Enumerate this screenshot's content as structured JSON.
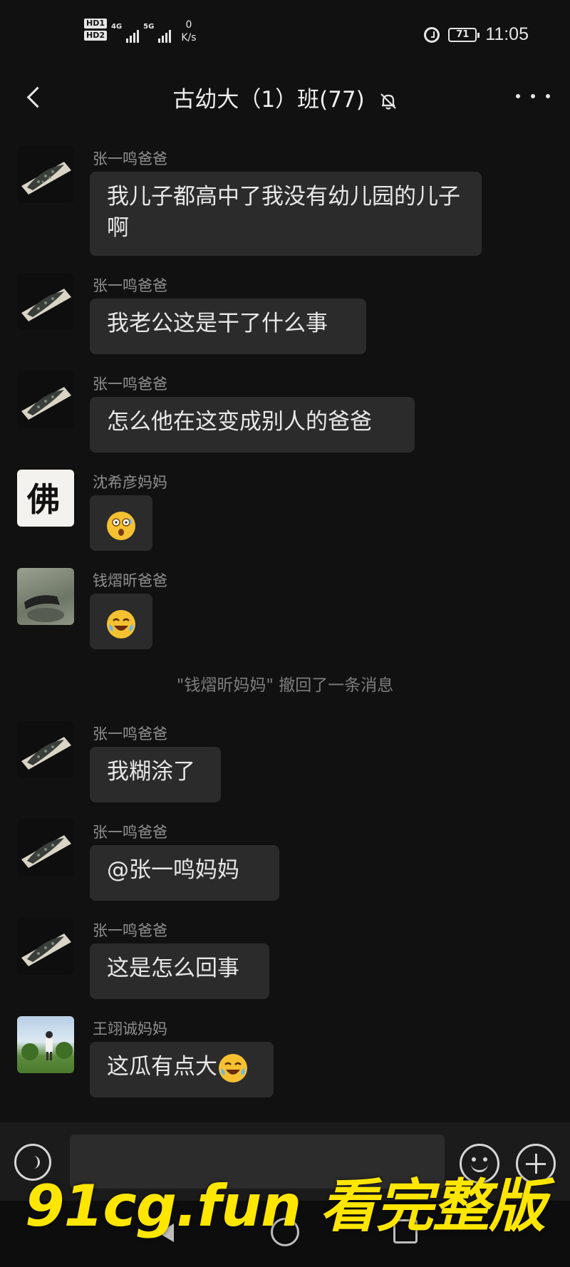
{
  "status_bar": {
    "sim1": "HD1",
    "sim2": "HD2",
    "network1": "4G",
    "network2": "5G",
    "speed_value": "0",
    "speed_unit": "K/s",
    "battery": "71",
    "time": "11:05"
  },
  "header": {
    "title": "古幼大（1）班(77)"
  },
  "messages": [
    {
      "sender": "张一鸣爸爸",
      "text": "我儿子都高中了我没有幼儿园的儿子啊"
    },
    {
      "sender": "张一鸣爸爸",
      "text": "我老公这是干了什么事"
    },
    {
      "sender": "张一鸣爸爸",
      "text": "怎么他在这变成别人的爸爸"
    },
    {
      "sender": "沈希彦妈妈",
      "emoji": "shocked-face-emoji"
    },
    {
      "sender": "钱熠昕爸爸",
      "emoji": "tears-of-joy-emoji"
    },
    {
      "sender": "张一鸣爸爸",
      "text": "我糊涂了"
    },
    {
      "sender": "张一鸣爸爸",
      "text": "@张一鸣妈妈"
    },
    {
      "sender": "张一鸣爸爸",
      "text": "这是怎么回事"
    },
    {
      "sender": "王翊诚妈妈",
      "text": "这瓜有点大"
    }
  ],
  "system_notice": "\"钱熠昕妈妈\" 撤回了一条消息",
  "avatar_glyph": "佛",
  "watermark": "91cg.fun 看完整版",
  "colors": {
    "background": "#111111",
    "bubble": "#2b2b2b",
    "watermark": "#ffe600"
  }
}
